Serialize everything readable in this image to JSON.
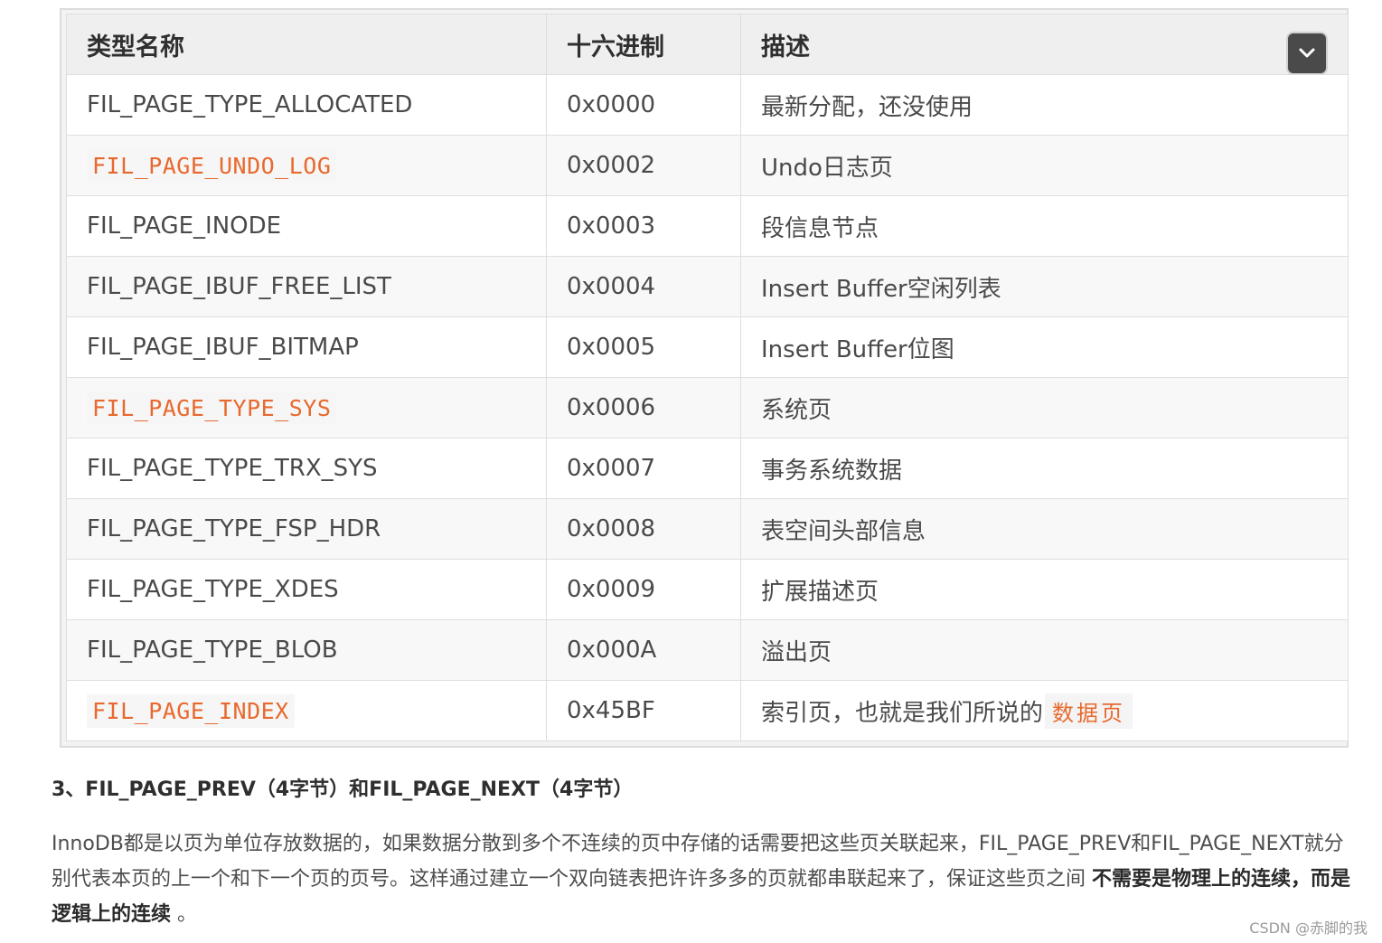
{
  "table": {
    "headers": [
      "类型名称",
      "十六进制",
      "描述"
    ],
    "rows": [
      {
        "name": "FIL_PAGE_TYPE_ALLOCATED",
        "hex": "0x0000",
        "desc": "最新分配，还没使用"
      },
      {
        "name": "FIL_PAGE_UNDO_LOG",
        "hex": "0x0002",
        "desc": "Undo日志页"
      },
      {
        "name": "FIL_PAGE_INODE",
        "hex": "0x0003",
        "desc": "段信息节点"
      },
      {
        "name": "FIL_PAGE_IBUF_FREE_LIST",
        "hex": "0x0004",
        "desc": "Insert Buffer空闲列表"
      },
      {
        "name": "FIL_PAGE_IBUF_BITMAP",
        "hex": "0x0005",
        "desc": "Insert Buffer位图"
      },
      {
        "name": "FIL_PAGE_TYPE_SYS",
        "hex": "0x0006",
        "desc": "系统页"
      },
      {
        "name": "FIL_PAGE_TYPE_TRX_SYS",
        "hex": "0x0007",
        "desc": "事务系统数据"
      },
      {
        "name": "FIL_PAGE_TYPE_FSP_HDR",
        "hex": "0x0008",
        "desc": "表空间头部信息"
      },
      {
        "name": "FIL_PAGE_TYPE_XDES",
        "hex": "0x0009",
        "desc": "扩展描述页"
      },
      {
        "name": "FIL_PAGE_TYPE_BLOB",
        "hex": "0x000A",
        "desc": "溢出页"
      },
      {
        "name": "FIL_PAGE_INDEX",
        "hex": "0x45BF",
        "desc": "索引页，也就是我们所说的",
        "desc_highlight": "数据页"
      }
    ],
    "collapse_icon": "chevron-down-icon"
  },
  "section": {
    "heading": "3、FIL_PAGE_PREV（4字节）和FIL_PAGE_NEXT（4字节）",
    "para_lead": "InnoDB都是以页为单位存放数据的，如果数据分散到多个不连续的页中存储的话需要把这些页关联起来，FIL_PAGE_PREV和FIL_PAGE_NEXT就分别代表本页的上一个和下一个页的页号。这样通过建立一个双向链表把许许多多的页就都串联起来了，保证这些页之间",
    "para_bold": "不需要是物理上的连续，而是逻辑上的连续",
    "para_tail": "。"
  },
  "watermark": "CSDN @赤脚的我",
  "colors": {
    "code_highlight": "#e8692e",
    "header_bg": "#efefef",
    "button_bg": "#4a4a4a"
  }
}
